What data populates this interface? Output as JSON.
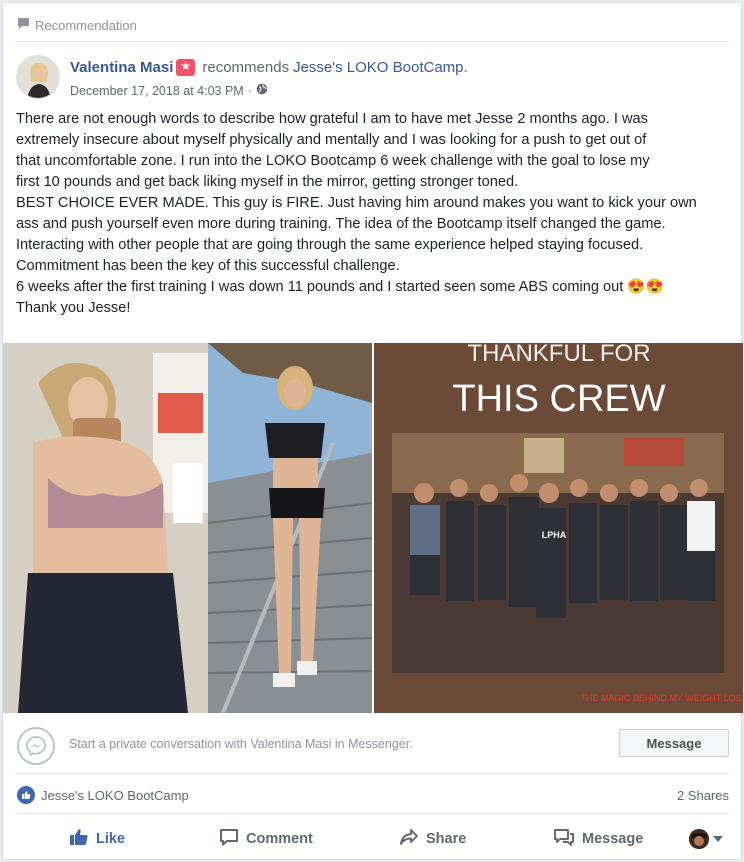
{
  "recommendation_header": {
    "label": "Recommendation",
    "icon": "speech-bubble-icon"
  },
  "post": {
    "author": "Valentina Masi",
    "badge_icon": "recommendation-star-icon",
    "verb": "recommends",
    "page": "Jesse's LOKO BootCamp.",
    "date": "December 17, 2018 at 4:03 PM",
    "separator": "·",
    "privacy_icon": "globe-icon",
    "body_lines": [
      "There are not enough words to describe how grateful I am to have met Jesse 2 months ago. I was",
      "extremely insecure about myself physically and mentally and I was looking for a push to get out of",
      "that uncomfortable zone. I run into the LOKO Bootcamp 6 week challenge with the goal to lose my",
      "first 10 pounds and get back liking myself in the mirror, getting stronger toned.",
      "BEST CHOICE EVER MADE. This guy is FIRE. Just having him around makes you want to kick your own",
      "ass and push yourself even more during training. The idea of the Bootcamp itself changed the game.",
      "Interacting with other people that are going through the same experience helped staying focused.",
      "Commitment has been the key of this successful challenge.",
      "6 weeks after the first training I was down 11 pounds and I started seen some ABS coming out",
      "Thank you Jesse!"
    ],
    "emoji": "😍😍"
  },
  "photos": {
    "left_alt": "selfie and staircase photos",
    "right_caption_top": "THANKFUL FOR",
    "right_caption_main": "THIS CREW",
    "right_caption_bottom": "THE MAGIC BEHIND MY WEIGHT LOSS",
    "right_shirt_text": "LPHA"
  },
  "messenger": {
    "text": "Start a private conversation with Valentina Masi in Messenger.",
    "button": "Message",
    "icon": "messenger-icon"
  },
  "stats": {
    "liker": "Jesse's LOKO BootCamp",
    "shares": "2 Shares"
  },
  "actions": {
    "like": "Like",
    "comment": "Comment",
    "share": "Share",
    "message": "Message"
  },
  "colors": {
    "link": "#385898",
    "like_blue": "#4267b2",
    "badge": "#f25268",
    "text": "#1d2129",
    "muted": "#90949c"
  }
}
